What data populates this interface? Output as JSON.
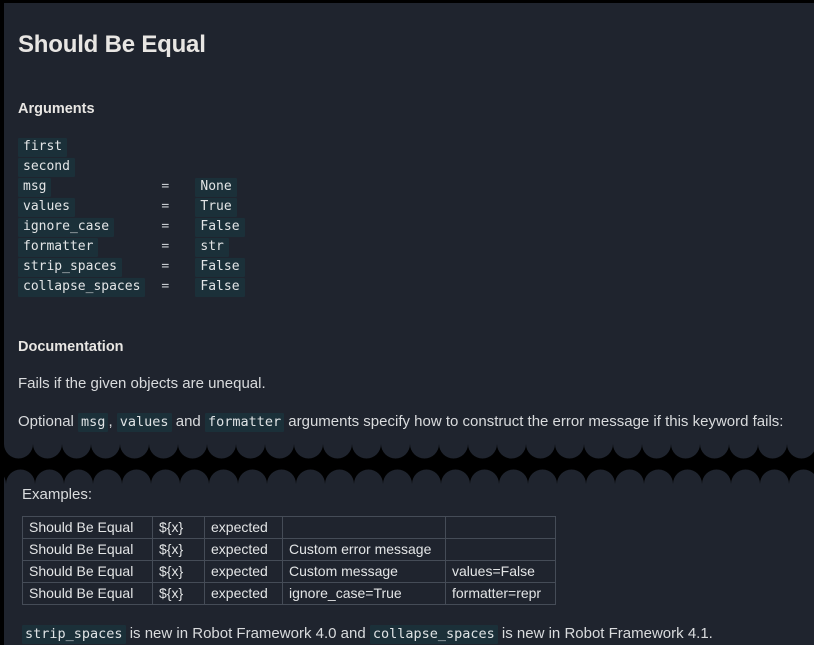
{
  "keyword": {
    "title": "Should Be Equal"
  },
  "sections": {
    "arguments_heading": "Arguments",
    "documentation_heading": "Documentation"
  },
  "arguments": [
    {
      "name": "first",
      "eq": "",
      "default": ""
    },
    {
      "name": "second",
      "eq": "",
      "default": ""
    },
    {
      "name": "msg",
      "eq": "=",
      "default": "None"
    },
    {
      "name": "values",
      "eq": "=",
      "default": "True"
    },
    {
      "name": "ignore_case",
      "eq": "=",
      "default": "False"
    },
    {
      "name": "formatter",
      "eq": "=",
      "default": "str"
    },
    {
      "name": "strip_spaces",
      "eq": "=",
      "default": "False"
    },
    {
      "name": "collapse_spaces",
      "eq": "=",
      "default": "False"
    }
  ],
  "documentation": {
    "paragraph_1": "Fails if the given objects are unequal.",
    "paragraph_2": {
      "part_1": "Optional ",
      "code_1": "msg",
      "part_2": ", ",
      "code_2": "values",
      "part_3": " and ",
      "code_3": "formatter",
      "part_4": " arguments specify how to construct the error message if this keyword fails:"
    }
  },
  "examples": {
    "label": "Examples:",
    "rows": [
      [
        "Should Be Equal",
        "${x}",
        "expected",
        "",
        ""
      ],
      [
        "Should Be Equal",
        "${x}",
        "expected",
        "Custom error message",
        ""
      ],
      [
        "Should Be Equal",
        "${x}",
        "expected",
        "Custom message",
        "values=False"
      ],
      [
        "Should Be Equal",
        "${x}",
        "expected",
        "ignore_case=True",
        "formatter=repr"
      ]
    ]
  },
  "note": {
    "code_1": "strip_spaces",
    "part_1": " is new in Robot Framework 4.0 and ",
    "code_2": "collapse_spaces",
    "part_2": " is new in Robot Framework 4.1."
  },
  "colors": {
    "page_background": "#1f242e",
    "frame": "#000000",
    "code_chip_background": "#1b3039",
    "text": "#d9dbdd",
    "heading": "#e8e6e3",
    "table_border": "#454c57"
  }
}
